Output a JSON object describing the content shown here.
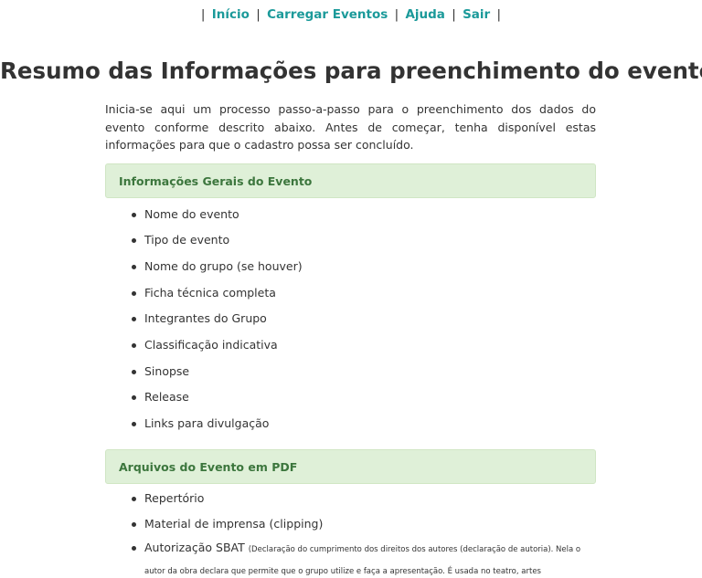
{
  "nav": {
    "pipe": "|",
    "links": [
      "Início",
      "Carregar Eventos",
      "Ajuda",
      "Sair"
    ]
  },
  "page_title": "Resumo das Informações para preenchimento do evento",
  "intro": "Inicia-se aqui um processo passo-a-passo para o preenchimento dos dados do evento conforme descrito abaixo. Antes de começar, tenha disponível estas informações para que o cadastro possa ser concluído.",
  "section_general": {
    "heading": "Informações Gerais do Evento",
    "items": [
      "Nome do evento",
      "Tipo de evento",
      "Nome do grupo (se houver)",
      "Ficha técnica completa",
      "Integrantes do Grupo",
      "Classificação indicativa",
      "Sinopse",
      "Release",
      "Links para divulgação"
    ]
  },
  "section_pdf": {
    "heading": "Arquivos do Evento em PDF",
    "items": [
      "Repertório",
      "Material de imprensa (clipping)"
    ],
    "sbat_label": "Autorização SBAT",
    "sbat_note": "(Declaração do cumprimento dos direitos dos autores (declaração de autoria). Nela o autor da obra declara que permite que o grupo utilize e faça a apresentação. É usada no teatro, artes cênicas,teatro, dança (autorização da"
  }
}
